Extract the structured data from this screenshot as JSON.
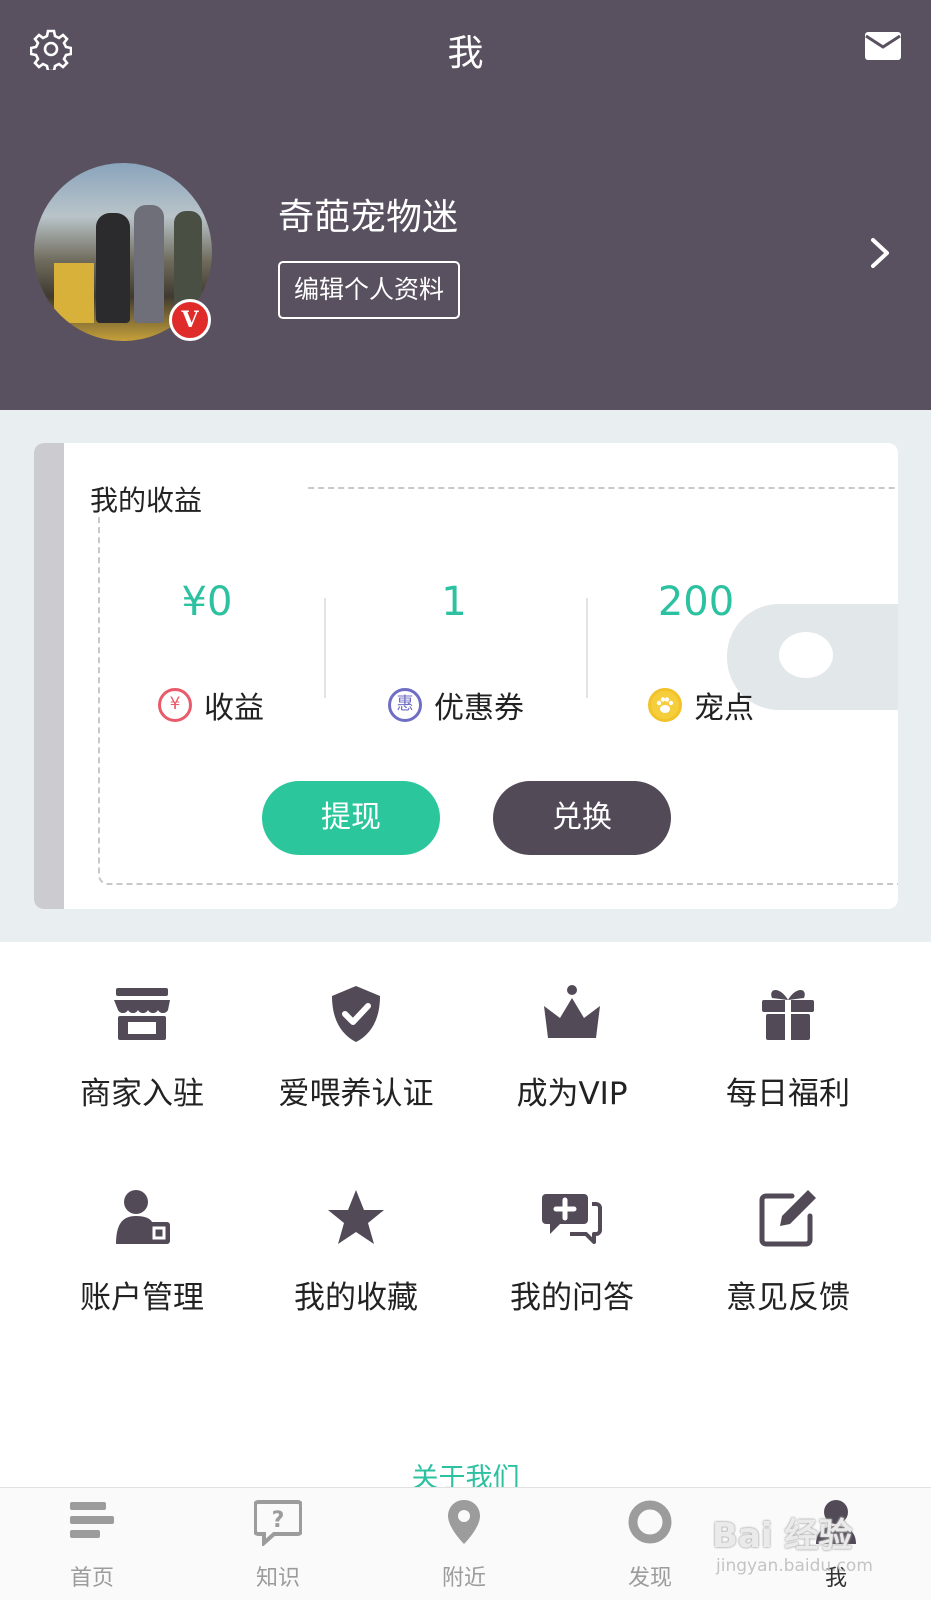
{
  "header": {
    "title": "我",
    "username": "奇葩宠物迷",
    "edit_profile_label": "编辑个人资料",
    "vip_badge": "V"
  },
  "earnings": {
    "title": "我的收益",
    "stats": [
      {
        "value": "¥0",
        "label": "收益",
        "icon": "yen-coin-icon",
        "coin_char": "¥"
      },
      {
        "value": "1",
        "label": "优惠券",
        "icon": "coupon-coin-icon",
        "coin_char": "惠"
      },
      {
        "value": "200",
        "label": "宠点",
        "icon": "paw-coin-icon",
        "coin_char": ""
      }
    ],
    "withdraw_label": "提现",
    "exchange_label": "兑换"
  },
  "menu": [
    {
      "label": "商家入驻",
      "icon": "store-icon"
    },
    {
      "label": "爱喂养认证",
      "icon": "shield-check-icon"
    },
    {
      "label": "成为VIP",
      "icon": "crown-icon"
    },
    {
      "label": "每日福利",
      "icon": "gift-icon"
    },
    {
      "label": "账户管理",
      "icon": "user-card-icon"
    },
    {
      "label": "我的收藏",
      "icon": "star-icon"
    },
    {
      "label": "我的问答",
      "icon": "chat-plus-icon"
    },
    {
      "label": "意见反馈",
      "icon": "edit-icon"
    }
  ],
  "about_link": "关于我们",
  "bottom_nav": [
    {
      "label": "首页",
      "icon": "home-list-icon"
    },
    {
      "label": "知识",
      "icon": "question-chat-icon"
    },
    {
      "label": "附近",
      "icon": "location-pin-icon"
    },
    {
      "label": "发现",
      "icon": "discover-ring-icon"
    },
    {
      "label": "我",
      "icon": "profile-icon"
    }
  ],
  "watermark": {
    "brand": "Bai 经验",
    "url": "jingyan.baidu.com"
  },
  "colors": {
    "header_bg": "#5a5160",
    "accent": "#2cc1a0",
    "dark_button": "#524a57",
    "badge_red": "#e02b2b"
  }
}
